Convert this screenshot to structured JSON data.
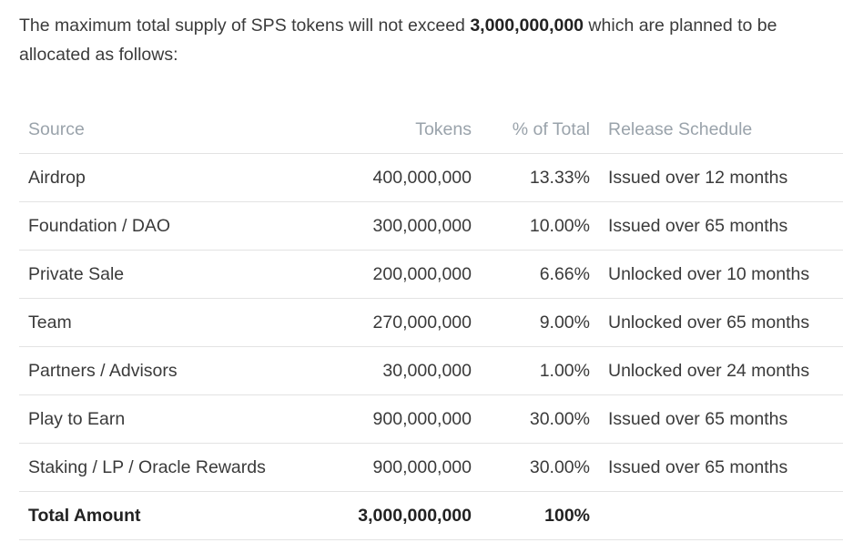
{
  "intro": {
    "before": "The maximum total supply of SPS tokens will not exceed ",
    "amount": "3,000,000,000",
    "after": " which are planned to be allocated as follows:"
  },
  "table": {
    "headers": {
      "source": "Source",
      "tokens": "Tokens",
      "percent": "% of Total",
      "release": "Release Schedule"
    },
    "rows": [
      {
        "source": "Airdrop",
        "tokens": "400,000,000",
        "percent": "13.33%",
        "release": "Issued over 12 months"
      },
      {
        "source": "Foundation / DAO",
        "tokens": "300,000,000",
        "percent": "10.00%",
        "release": "Issued over 65 months"
      },
      {
        "source": "Private Sale",
        "tokens": "200,000,000",
        "percent": "6.66%",
        "release": "Unlocked over 10 months"
      },
      {
        "source": "Team",
        "tokens": "270,000,000",
        "percent": "9.00%",
        "release": "Unlocked over 65 months"
      },
      {
        "source": "Partners / Advisors",
        "tokens": "30,000,000",
        "percent": "1.00%",
        "release": "Unlocked over 24 months"
      },
      {
        "source": "Play to Earn",
        "tokens": "900,000,000",
        "percent": "30.00%",
        "release": "Issued over 65 months"
      },
      {
        "source": "Staking / LP / Oracle Rewards",
        "tokens": "900,000,000",
        "percent": "30.00%",
        "release": "Issued over 65 months"
      }
    ],
    "total": {
      "source": "Total Amount",
      "tokens": "3,000,000,000",
      "percent": "100%",
      "release": ""
    }
  }
}
